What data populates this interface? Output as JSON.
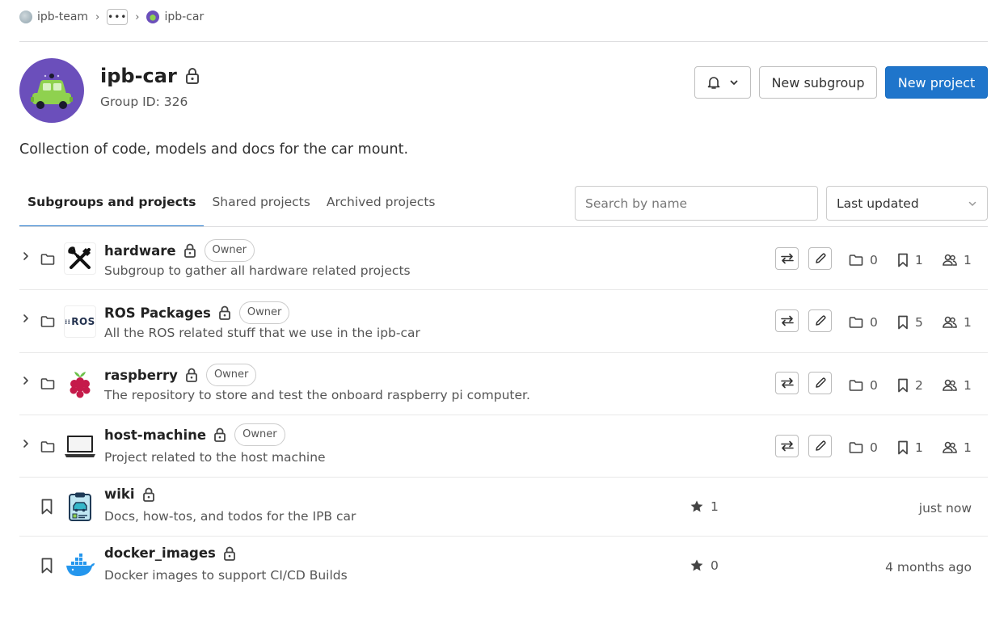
{
  "breadcrumb": {
    "items": [
      "ipb-team",
      "ipb-car"
    ],
    "more_label": "•••"
  },
  "group": {
    "title": "ipb-car",
    "id_text": "Group ID: 326",
    "description": "Collection of code, models and docs for the car mount."
  },
  "header_buttons": {
    "notifications_icon": "bell-icon",
    "new_subgroup": "New subgroup",
    "new_project": "New project"
  },
  "tabs": [
    "Subgroups and projects",
    "Shared projects",
    "Archived projects"
  ],
  "active_tab": 0,
  "search": {
    "placeholder": "Search by name"
  },
  "sort": {
    "selected": "Last updated"
  },
  "subgroups": [
    {
      "name": "hardware",
      "badge": "Owner",
      "description": "Subgroup to gather all hardware related projects",
      "subgroups": "0",
      "projects": "1",
      "members": "1"
    },
    {
      "name": "ROS Packages",
      "badge": "Owner",
      "description": "All the ROS related stuff that we use in the ipb-car",
      "subgroups": "0",
      "projects": "5",
      "members": "1",
      "avatar_text": "ROS"
    },
    {
      "name": "raspberry",
      "badge": "Owner",
      "description": "The repository to store and test the onboard raspberry pi computer.",
      "subgroups": "0",
      "projects": "2",
      "members": "1"
    },
    {
      "name": "host-machine",
      "badge": "Owner",
      "description": "Project related to the host machine",
      "subgroups": "0",
      "projects": "1",
      "members": "1"
    }
  ],
  "projects": [
    {
      "name": "wiki",
      "description": "Docs, how-tos, and todos for the IPB car",
      "stars": "1",
      "updated": "just now"
    },
    {
      "name": "docker_images",
      "description": "Docker images to support CI/CD Builds",
      "stars": "0",
      "updated": "4 months ago"
    }
  ],
  "colors": {
    "primary": "#1f75cb",
    "avatar_bg": "#6b4fbb",
    "car": "#8fd14f"
  }
}
